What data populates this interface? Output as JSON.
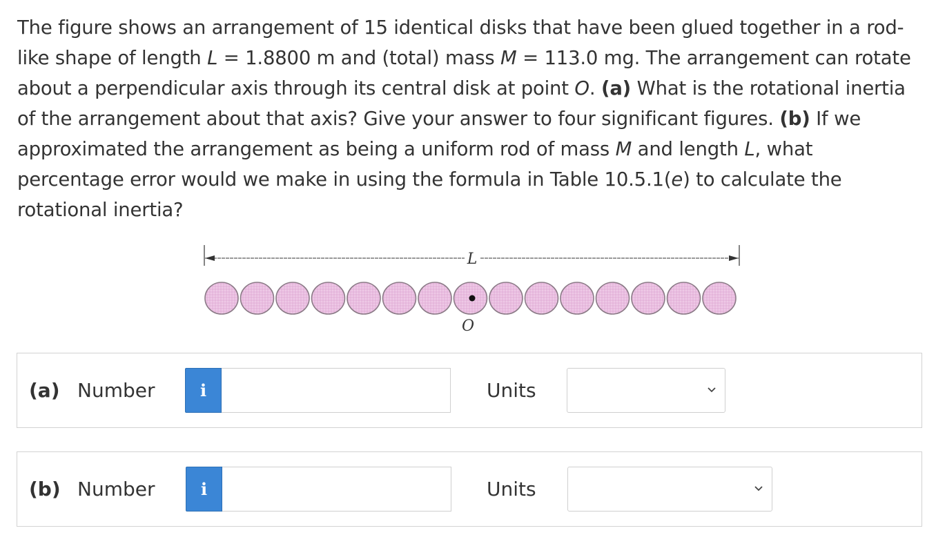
{
  "question": {
    "p1": "The figure shows an arrangement of 15 identical disks that have been glued together in a rod-like shape of length ",
    "L_sym": "L",
    "p2": " = 1.8800 m and (total) mass ",
    "M_sym": "M",
    "p3": " = 113.0 mg. The arrangement can rotate about a perpendicular axis through its central disk at point ",
    "O_sym": "O",
    "p4": ". ",
    "a_tag": "(a)",
    "p5": " What is the rotational inertia of the arrangement about that axis? Give your answer to four significant figures. ",
    "b_tag": "(b)",
    "p6": " If we approximated the arrangement as being a uniform rod of mass ",
    "M_sym2": "M",
    "p7": " and length ",
    "L_sym2": "L",
    "p8": ", what percentage error would we make in using the formula in Table 10.5.1(",
    "e_sym": "e",
    "p9": ") to calculate the rotational inertia?"
  },
  "figure": {
    "length_label": "L",
    "point_label": "O",
    "disk_count": 15,
    "disk_fill": "#e7b6dc",
    "disk_stroke": "#8a7a86"
  },
  "answers": [
    {
      "part": "(a)",
      "number_label": "Number",
      "info_icon": "i",
      "value": "",
      "units_label": "Units",
      "units_value": ""
    },
    {
      "part": "(b)",
      "number_label": "Number",
      "info_icon": "i",
      "value": "",
      "units_label": "Units",
      "units_value": ""
    }
  ],
  "colors": {
    "info_button": "#3b86d6",
    "border": "#d2d2d2"
  }
}
